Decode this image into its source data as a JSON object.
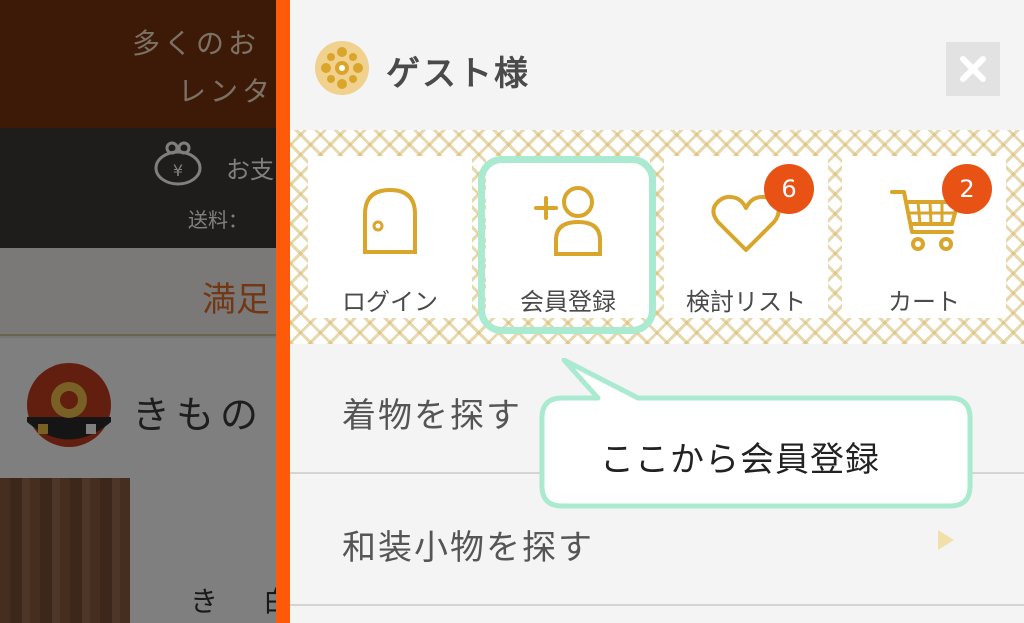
{
  "background_page": {
    "banner_line1": "多くのお",
    "banner_line2": "レンタ",
    "payment_text": "お支",
    "shipping_text": "送料：",
    "satisfaction_text": "満足",
    "brand_text": "きもの",
    "lower_text": "き 白"
  },
  "menu": {
    "user_label": "ゲスト様",
    "close_icon": "close-icon",
    "quick_links": [
      {
        "label": "ログイン",
        "icon": "door-icon"
      },
      {
        "label": "会員登録",
        "icon": "add-user-icon"
      },
      {
        "label": "検討リスト",
        "icon": "heart-icon",
        "badge": "6"
      },
      {
        "label": "カート",
        "icon": "cart-icon",
        "badge": "2"
      }
    ],
    "rows": [
      {
        "label": "着物を探す"
      },
      {
        "label": "和装小物を探す"
      }
    ]
  },
  "callout": {
    "text": "ここから会員登録"
  },
  "colors": {
    "accent_orange": "#ff5a0a",
    "badge": "#e85214",
    "icon_gold": "#d9a52b",
    "highlight_green": "#a9ead1"
  }
}
